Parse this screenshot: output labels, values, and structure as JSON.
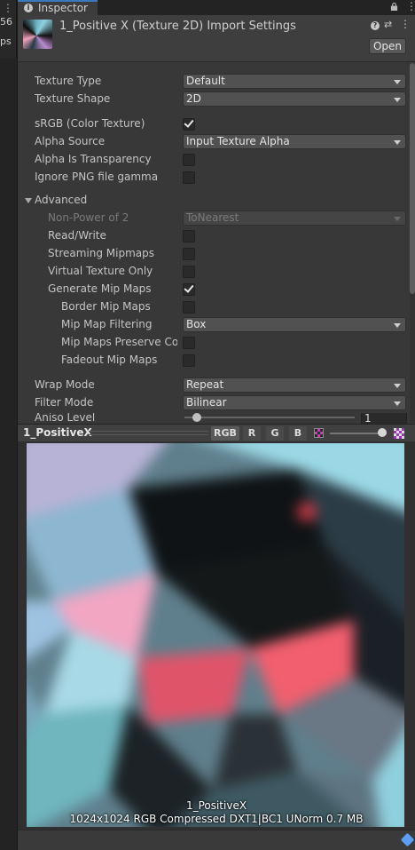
{
  "left": {
    "label1": "56",
    "label2": "ps"
  },
  "tab": {
    "label": "Inspector"
  },
  "header": {
    "title": "1_Positive X (Texture 2D) Import Settings",
    "open_label": "Open"
  },
  "props": {
    "texture_type": {
      "label": "Texture Type",
      "value": "Default"
    },
    "texture_shape": {
      "label": "Texture Shape",
      "value": "2D"
    },
    "srgb": {
      "label": "sRGB (Color Texture)",
      "checked": true
    },
    "alpha_source": {
      "label": "Alpha Source",
      "value": "Input Texture Alpha"
    },
    "alpha_transparency": {
      "label": "Alpha Is Transparency",
      "checked": false
    },
    "ignore_png": {
      "label": "Ignore PNG file gamma",
      "checked": false
    },
    "advanced": {
      "label": "Advanced"
    },
    "non_power": {
      "label": "Non-Power of 2",
      "value": "ToNearest"
    },
    "read_write": {
      "label": "Read/Write",
      "checked": false
    },
    "streaming_mipmaps": {
      "label": "Streaming Mipmaps",
      "checked": false
    },
    "virtual_texture": {
      "label": "Virtual Texture Only",
      "checked": false
    },
    "generate_mipmaps": {
      "label": "Generate Mip Maps",
      "checked": true
    },
    "border_mipmaps": {
      "label": "Border Mip Maps",
      "checked": false
    },
    "mip_filtering": {
      "label": "Mip Map Filtering",
      "value": "Box"
    },
    "preserve_coverage": {
      "label": "Mip Maps Preserve Coverage",
      "checked": false
    },
    "fadeout_mipmaps": {
      "label": "Fadeout Mip Maps",
      "checked": false
    },
    "wrap_mode": {
      "label": "Wrap Mode",
      "value": "Repeat"
    },
    "filter_mode": {
      "label": "Filter Mode",
      "value": "Bilinear"
    },
    "aniso_level": {
      "label": "Aniso Level",
      "value": "1",
      "level": 1
    }
  },
  "preview": {
    "name": "1_PositiveX",
    "channels": [
      "RGB",
      "R",
      "G",
      "B"
    ],
    "info_name": "1_PositiveX",
    "info_details": "1024x1024  RGB Compressed DXT1|BC1 UNorm  0.7 MB"
  },
  "icons": {
    "info": "info-icon",
    "lock": "lock-icon",
    "kebab": "kebab-menu-icon",
    "help": "help-icon",
    "preset": "preset-icon",
    "more": "more-icon",
    "alpha": "alpha-toggle-icon",
    "checker": "checker-icon",
    "tag": "asset-label-icon"
  },
  "colors": {
    "accent": "#3a79bb",
    "panel": "#383838"
  }
}
